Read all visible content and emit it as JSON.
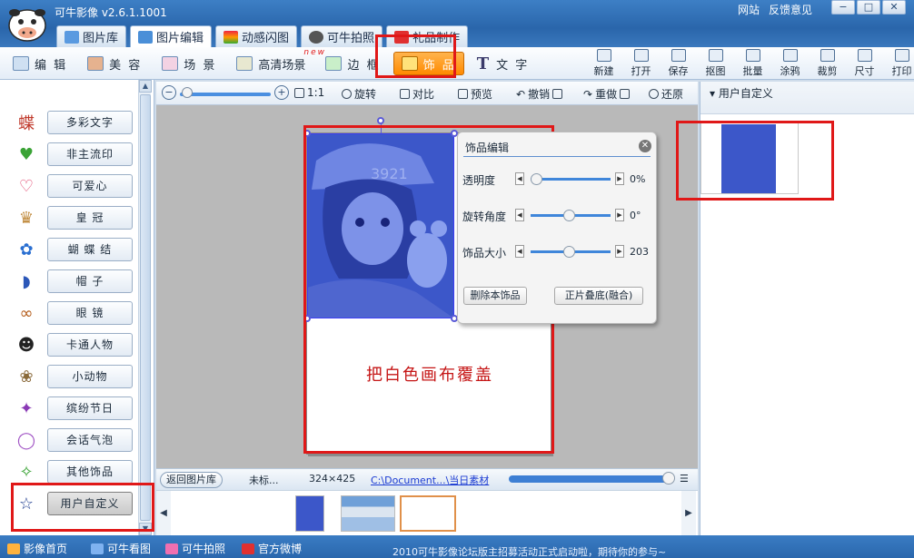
{
  "app": {
    "title": "可牛影像 v2.6.1.1001",
    "links": [
      "网站",
      "反馈意见"
    ],
    "window_buttons": [
      "−",
      "□",
      "✕"
    ]
  },
  "main_tabs": [
    {
      "label": "图片库",
      "icon": "gallery-icon"
    },
    {
      "label": "图片编辑",
      "icon": "edit-picture-icon",
      "active": true
    },
    {
      "label": "动感闪图",
      "icon": "flash-icon"
    },
    {
      "label": "可牛拍照",
      "icon": "camera-icon"
    },
    {
      "label": "礼品制作",
      "icon": "gift-icon"
    }
  ],
  "sub_tabs": [
    {
      "label": "编 辑",
      "icon": "edit-icon"
    },
    {
      "label": "美 容",
      "icon": "beauty-icon"
    },
    {
      "label": "场 景",
      "icon": "scene-icon"
    },
    {
      "label": "高清场景",
      "icon": "hd-scene-icon",
      "badge": "new"
    },
    {
      "label": "边 框",
      "icon": "frame-icon"
    },
    {
      "label": "饰 品",
      "icon": "accessory-icon",
      "active": true
    },
    {
      "label": "文 字",
      "icon": "text-icon"
    }
  ],
  "tools": [
    "新建",
    "打开",
    "保存",
    "抠图",
    "批量",
    "涂鸦",
    "裁剪",
    "尺寸",
    "打印"
  ],
  "deco_categories": [
    {
      "label": "多彩文字",
      "icon": "colorful-text-icon",
      "glyph": "蝶",
      "color": "#c0392b"
    },
    {
      "label": "非主流印",
      "icon": "heart-stamp-icon",
      "glyph": "♥",
      "color": "#3aa335"
    },
    {
      "label": "可爱心",
      "icon": "heart-icon",
      "glyph": "♡",
      "color": "#e0406a"
    },
    {
      "label": "皇 冠",
      "icon": "crown-icon",
      "glyph": "♛",
      "color": "#c08a3c"
    },
    {
      "label": "蝴 蝶 结",
      "icon": "bow-icon",
      "glyph": "✿",
      "color": "#2a6fd1"
    },
    {
      "label": "帽 子",
      "icon": "hat-icon",
      "glyph": "◗",
      "color": "#2b57b8"
    },
    {
      "label": "眼 镜",
      "icon": "glasses-icon",
      "glyph": "∞",
      "color": "#b35a17"
    },
    {
      "label": "卡通人物",
      "icon": "cartoon-icon",
      "glyph": "☻",
      "color": "#222222"
    },
    {
      "label": "小动物",
      "icon": "animal-icon",
      "glyph": "❀",
      "color": "#8a6a3a"
    },
    {
      "label": "缤纷节日",
      "icon": "festival-icon",
      "glyph": "✦",
      "color": "#8a3ab5"
    },
    {
      "label": "会话气泡",
      "icon": "speech-bubble-icon",
      "glyph": "◯",
      "color": "#a052c4"
    },
    {
      "label": "其他饰品",
      "icon": "misc-icon",
      "glyph": "✧",
      "color": "#3aa335"
    },
    {
      "label": "用户自定义",
      "icon": "star-icon",
      "glyph": "☆",
      "color": "#1d3c8f",
      "selected": true
    }
  ],
  "edit_bar": {
    "zoom_ratio": "1:1",
    "items": [
      "旋转",
      "对比",
      "预览",
      "撤销",
      "重做",
      "还原"
    ]
  },
  "canvas": {
    "overlay_text": "把白色画布覆盖",
    "photo_caption": "3921"
  },
  "deco_panel": {
    "title": "饰品编辑",
    "sliders": [
      {
        "label": "透明度",
        "value": "0%",
        "level": 0.05
      },
      {
        "label": "旋转角度",
        "value": "0°",
        "level": 0.5
      },
      {
        "label": "饰品大小",
        "value": "203",
        "level": 0.5
      }
    ],
    "delete_button": "删除本饰品",
    "blend_button": "正片叠底(融合)"
  },
  "file_bar": {
    "back_button": "返回图片库",
    "file_name": "未标...",
    "size": "324×425",
    "path": "C:\\Document...\\当日素材",
    "progress": 0.97
  },
  "right_panel": {
    "title": "用户自定义"
  },
  "bottom_bar": {
    "links": [
      {
        "label": "影像首页",
        "icon": "home-icon"
      },
      {
        "label": "可牛看图",
        "icon": "viewer-icon"
      },
      {
        "label": "可牛拍照",
        "icon": "camera-icon"
      },
      {
        "label": "官方微博",
        "icon": "weibo-icon"
      }
    ],
    "marquee": "2010可牛影像论坛版主招募活动正式启动啦，期待你的参与~"
  },
  "colors": {
    "accent": "#2a66ab",
    "active_tab": "#ff8a00",
    "highlight": "#e01818",
    "photo_tint": "#3c57c9"
  }
}
